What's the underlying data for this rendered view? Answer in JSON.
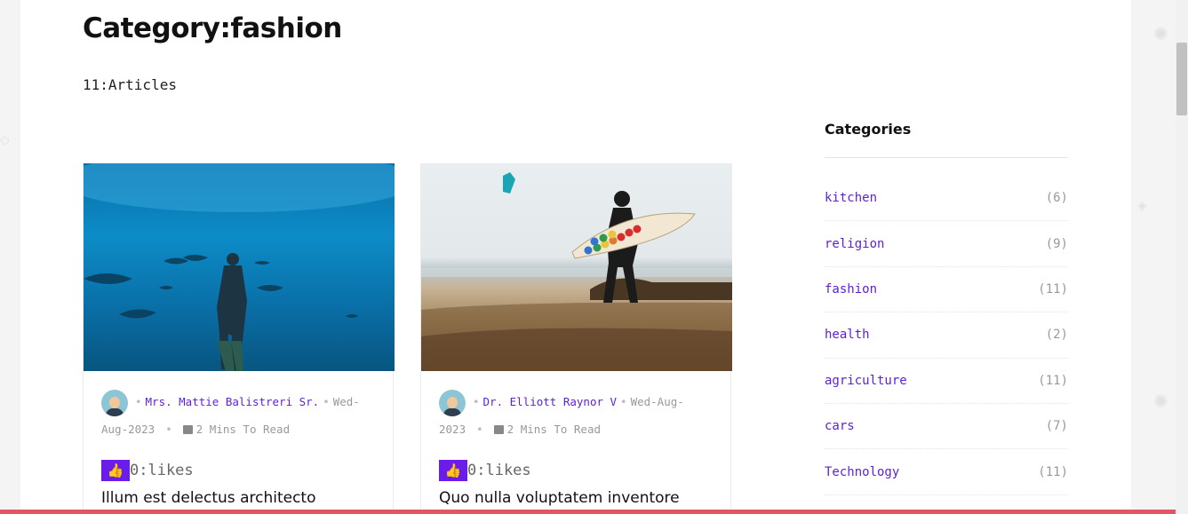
{
  "page": {
    "title": "Category:fashion",
    "article_count": "11:Articles"
  },
  "articles": [
    {
      "image": "underwater-diver-photo",
      "author": "Mrs. Mattie Balistreri Sr.",
      "date": "Wed-Aug-2023",
      "read_time": "2 Mins To Read",
      "likes": "0:likes",
      "title": "Illum est delectus architecto"
    },
    {
      "image": "surfer-on-beach-photo",
      "author": "Dr. Elliott Raynor V",
      "date": "Wed-Aug-2023",
      "read_time": "2 Mins To Read",
      "likes": "0:likes",
      "title": "Quo nulla voluptatem inventore"
    }
  ],
  "sidebar": {
    "title": "Categories",
    "categories": [
      {
        "name": "kitchen",
        "count": "(6)"
      },
      {
        "name": "religion",
        "count": "(9)"
      },
      {
        "name": "fashion",
        "count": "(11)"
      },
      {
        "name": "health",
        "count": "(2)"
      },
      {
        "name": "agriculture",
        "count": "(11)"
      },
      {
        "name": "cars",
        "count": "(7)"
      },
      {
        "name": "Technology",
        "count": "(11)"
      }
    ]
  },
  "colors": {
    "accent": "#5c1fd8",
    "like_button": "#6a1de8",
    "bottom_bar": "#e25563"
  },
  "icons": {
    "like": "thumbs-up-icon",
    "read_time": "book-icon"
  }
}
